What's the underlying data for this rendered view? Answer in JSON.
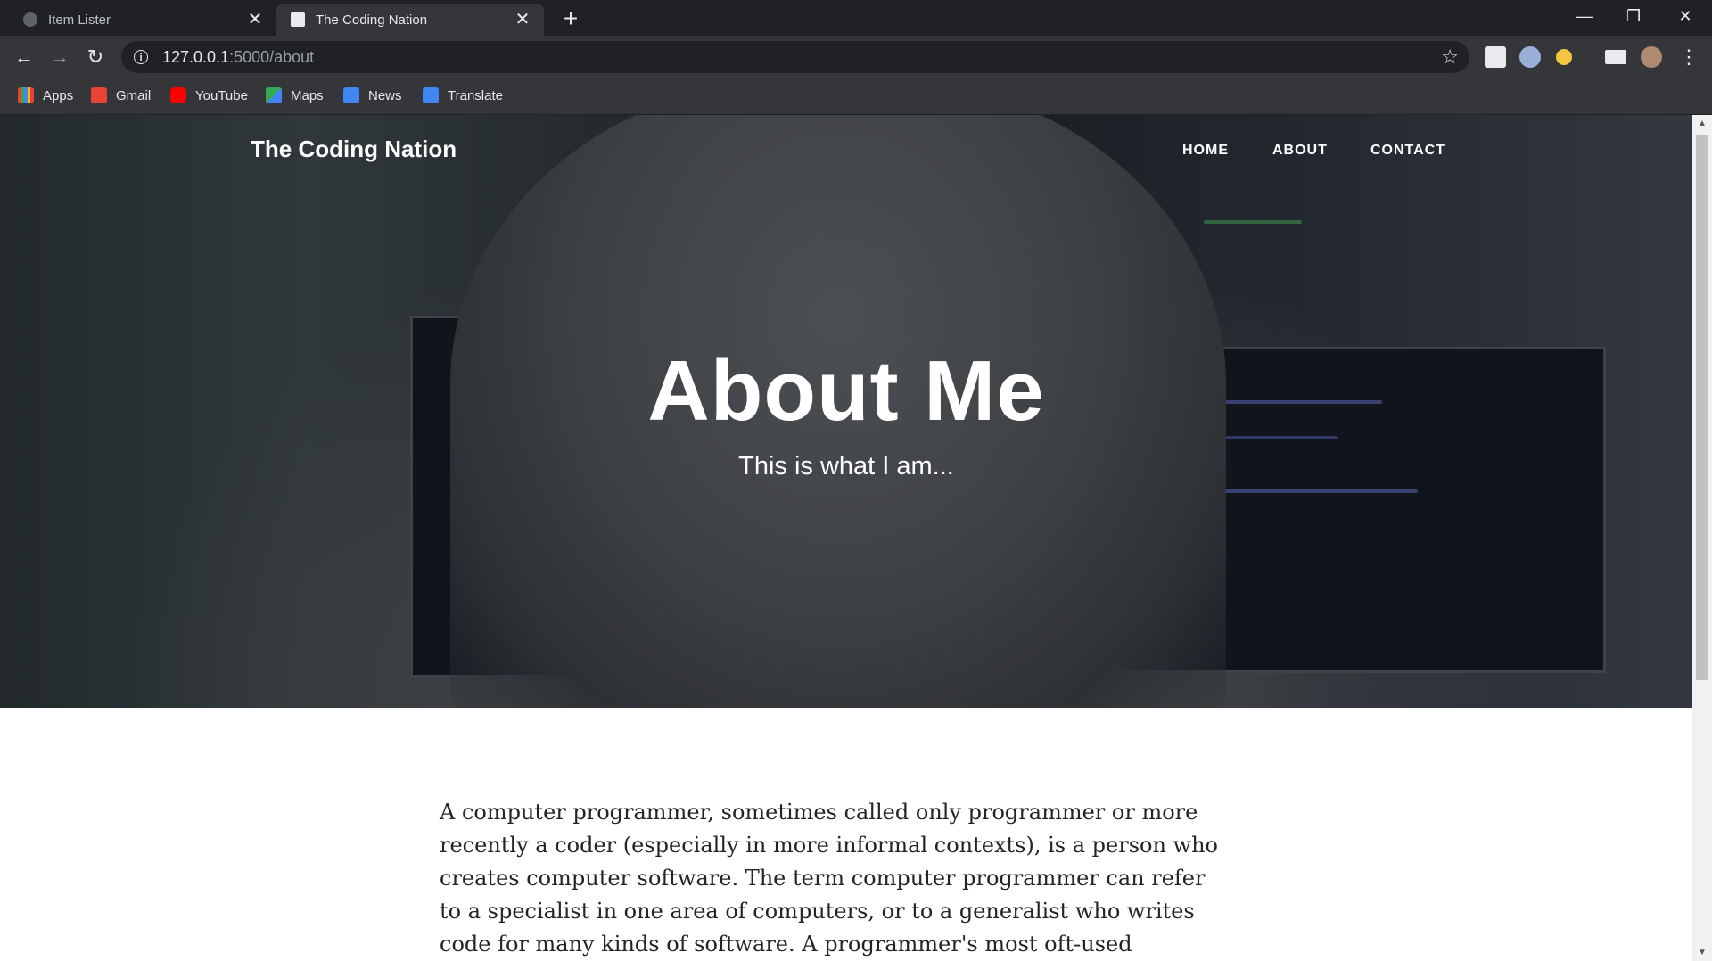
{
  "browser": {
    "tabs": [
      {
        "title": "Item Lister",
        "active": false
      },
      {
        "title": "The Coding Nation",
        "active": true
      }
    ],
    "url": {
      "host": "127.0.0.1",
      "path": ":5000/about"
    },
    "bookmarks": [
      {
        "label": "Apps",
        "icon": "apps-grid-icon"
      },
      {
        "label": "Gmail",
        "icon": "gmail-icon"
      },
      {
        "label": "YouTube",
        "icon": "youtube-icon"
      },
      {
        "label": "Maps",
        "icon": "maps-icon"
      },
      {
        "label": "News",
        "icon": "news-icon"
      },
      {
        "label": "Translate",
        "icon": "translate-icon"
      }
    ]
  },
  "site": {
    "brand": "The Coding Nation",
    "nav": [
      "HOME",
      "ABOUT",
      "CONTACT"
    ]
  },
  "hero": {
    "title": "About Me",
    "subtitle": "This is what I am..."
  },
  "content": {
    "paragraph": "A computer programmer, sometimes called only programmer or more recently a coder (especially in more informal contexts), is a person who creates computer software. The term computer programmer can refer to a specialist in one area of computers, or to a generalist who writes code for many kinds of software. A programmer's most oft-used computer language"
  }
}
